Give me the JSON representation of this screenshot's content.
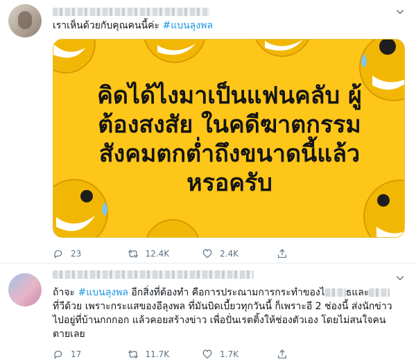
{
  "tweets": [
    {
      "text": "เราเห็นด้วยกับคุณคนนี้ค่ะ",
      "hashtag": "#แบนลุงพล",
      "media_text": [
        "คิดได้ไงมาเป็นแฟนคลับ ผู้",
        "ต้องสงสัย ในคดีฆาตกรรม",
        "สังคมตกต่ำถึงขนาดนี้แล้ว",
        "หรอครับ"
      ],
      "replies": "23",
      "retweets": "12.4K",
      "likes": "2.4K"
    },
    {
      "prefix": "ถ้าจะ",
      "hashtag": "#แบนลุงพล",
      "body_line1": " อีกสิ่งที่ต้องทำ คือการประณามการกระทำของไ",
      "body_line1b": "ธและ",
      "body_line2": "ที่วีด้วย เพราะกระแสของอีลุงพล ที่มันบิดเบี้ยวทุกวันนี้ ก็เพราะอี 2 ช่องนี้ ส่งนักข่าว",
      "body_line3": "ไปอยู่ที่บ้านกกกอก แล้วคอยสร้างข่าว เพื่อปั่นเรตติ้งให้ช่องตัวเอง โดยไม่สนใจคน",
      "body_line4": "ตายเลย",
      "replies": "17",
      "retweets": "11.7K",
      "likes": "1.7K"
    }
  ],
  "icons": [
    "chevron-down-icon",
    "reply-icon",
    "retweet-icon",
    "like-icon",
    "share-icon"
  ],
  "colors": {
    "hashtag": "#1b95e0",
    "media_bg": "#ffc61a",
    "icon_gray": "#5b7083"
  }
}
